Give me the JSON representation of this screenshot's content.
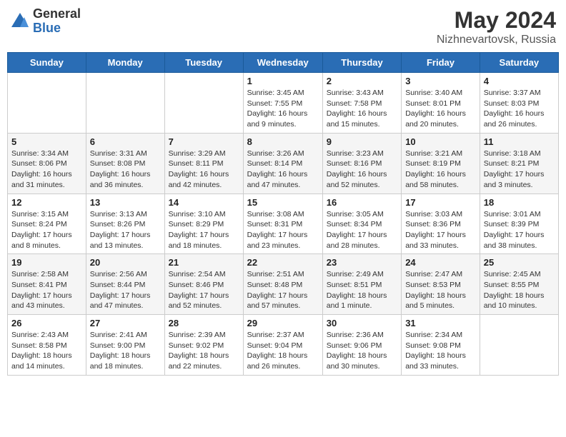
{
  "header": {
    "logo_general": "General",
    "logo_blue": "Blue",
    "month_year": "May 2024",
    "location": "Nizhnevartovsk, Russia"
  },
  "weekdays": [
    "Sunday",
    "Monday",
    "Tuesday",
    "Wednesday",
    "Thursday",
    "Friday",
    "Saturday"
  ],
  "weeks": [
    [
      {
        "day": "",
        "info": ""
      },
      {
        "day": "",
        "info": ""
      },
      {
        "day": "",
        "info": ""
      },
      {
        "day": "1",
        "info": "Sunrise: 3:45 AM\nSunset: 7:55 PM\nDaylight: 16 hours\nand 9 minutes."
      },
      {
        "day": "2",
        "info": "Sunrise: 3:43 AM\nSunset: 7:58 PM\nDaylight: 16 hours\nand 15 minutes."
      },
      {
        "day": "3",
        "info": "Sunrise: 3:40 AM\nSunset: 8:01 PM\nDaylight: 16 hours\nand 20 minutes."
      },
      {
        "day": "4",
        "info": "Sunrise: 3:37 AM\nSunset: 8:03 PM\nDaylight: 16 hours\nand 26 minutes."
      }
    ],
    [
      {
        "day": "5",
        "info": "Sunrise: 3:34 AM\nSunset: 8:06 PM\nDaylight: 16 hours\nand 31 minutes."
      },
      {
        "day": "6",
        "info": "Sunrise: 3:31 AM\nSunset: 8:08 PM\nDaylight: 16 hours\nand 36 minutes."
      },
      {
        "day": "7",
        "info": "Sunrise: 3:29 AM\nSunset: 8:11 PM\nDaylight: 16 hours\nand 42 minutes."
      },
      {
        "day": "8",
        "info": "Sunrise: 3:26 AM\nSunset: 8:14 PM\nDaylight: 16 hours\nand 47 minutes."
      },
      {
        "day": "9",
        "info": "Sunrise: 3:23 AM\nSunset: 8:16 PM\nDaylight: 16 hours\nand 52 minutes."
      },
      {
        "day": "10",
        "info": "Sunrise: 3:21 AM\nSunset: 8:19 PM\nDaylight: 16 hours\nand 58 minutes."
      },
      {
        "day": "11",
        "info": "Sunrise: 3:18 AM\nSunset: 8:21 PM\nDaylight: 17 hours\nand 3 minutes."
      }
    ],
    [
      {
        "day": "12",
        "info": "Sunrise: 3:15 AM\nSunset: 8:24 PM\nDaylight: 17 hours\nand 8 minutes."
      },
      {
        "day": "13",
        "info": "Sunrise: 3:13 AM\nSunset: 8:26 PM\nDaylight: 17 hours\nand 13 minutes."
      },
      {
        "day": "14",
        "info": "Sunrise: 3:10 AM\nSunset: 8:29 PM\nDaylight: 17 hours\nand 18 minutes."
      },
      {
        "day": "15",
        "info": "Sunrise: 3:08 AM\nSunset: 8:31 PM\nDaylight: 17 hours\nand 23 minutes."
      },
      {
        "day": "16",
        "info": "Sunrise: 3:05 AM\nSunset: 8:34 PM\nDaylight: 17 hours\nand 28 minutes."
      },
      {
        "day": "17",
        "info": "Sunrise: 3:03 AM\nSunset: 8:36 PM\nDaylight: 17 hours\nand 33 minutes."
      },
      {
        "day": "18",
        "info": "Sunrise: 3:01 AM\nSunset: 8:39 PM\nDaylight: 17 hours\nand 38 minutes."
      }
    ],
    [
      {
        "day": "19",
        "info": "Sunrise: 2:58 AM\nSunset: 8:41 PM\nDaylight: 17 hours\nand 43 minutes."
      },
      {
        "day": "20",
        "info": "Sunrise: 2:56 AM\nSunset: 8:44 PM\nDaylight: 17 hours\nand 47 minutes."
      },
      {
        "day": "21",
        "info": "Sunrise: 2:54 AM\nSunset: 8:46 PM\nDaylight: 17 hours\nand 52 minutes."
      },
      {
        "day": "22",
        "info": "Sunrise: 2:51 AM\nSunset: 8:48 PM\nDaylight: 17 hours\nand 57 minutes."
      },
      {
        "day": "23",
        "info": "Sunrise: 2:49 AM\nSunset: 8:51 PM\nDaylight: 18 hours\nand 1 minute."
      },
      {
        "day": "24",
        "info": "Sunrise: 2:47 AM\nSunset: 8:53 PM\nDaylight: 18 hours\nand 5 minutes."
      },
      {
        "day": "25",
        "info": "Sunrise: 2:45 AM\nSunset: 8:55 PM\nDaylight: 18 hours\nand 10 minutes."
      }
    ],
    [
      {
        "day": "26",
        "info": "Sunrise: 2:43 AM\nSunset: 8:58 PM\nDaylight: 18 hours\nand 14 minutes."
      },
      {
        "day": "27",
        "info": "Sunrise: 2:41 AM\nSunset: 9:00 PM\nDaylight: 18 hours\nand 18 minutes."
      },
      {
        "day": "28",
        "info": "Sunrise: 2:39 AM\nSunset: 9:02 PM\nDaylight: 18 hours\nand 22 minutes."
      },
      {
        "day": "29",
        "info": "Sunrise: 2:37 AM\nSunset: 9:04 PM\nDaylight: 18 hours\nand 26 minutes."
      },
      {
        "day": "30",
        "info": "Sunrise: 2:36 AM\nSunset: 9:06 PM\nDaylight: 18 hours\nand 30 minutes."
      },
      {
        "day": "31",
        "info": "Sunrise: 2:34 AM\nSunset: 9:08 PM\nDaylight: 18 hours\nand 33 minutes."
      },
      {
        "day": "",
        "info": ""
      }
    ]
  ]
}
